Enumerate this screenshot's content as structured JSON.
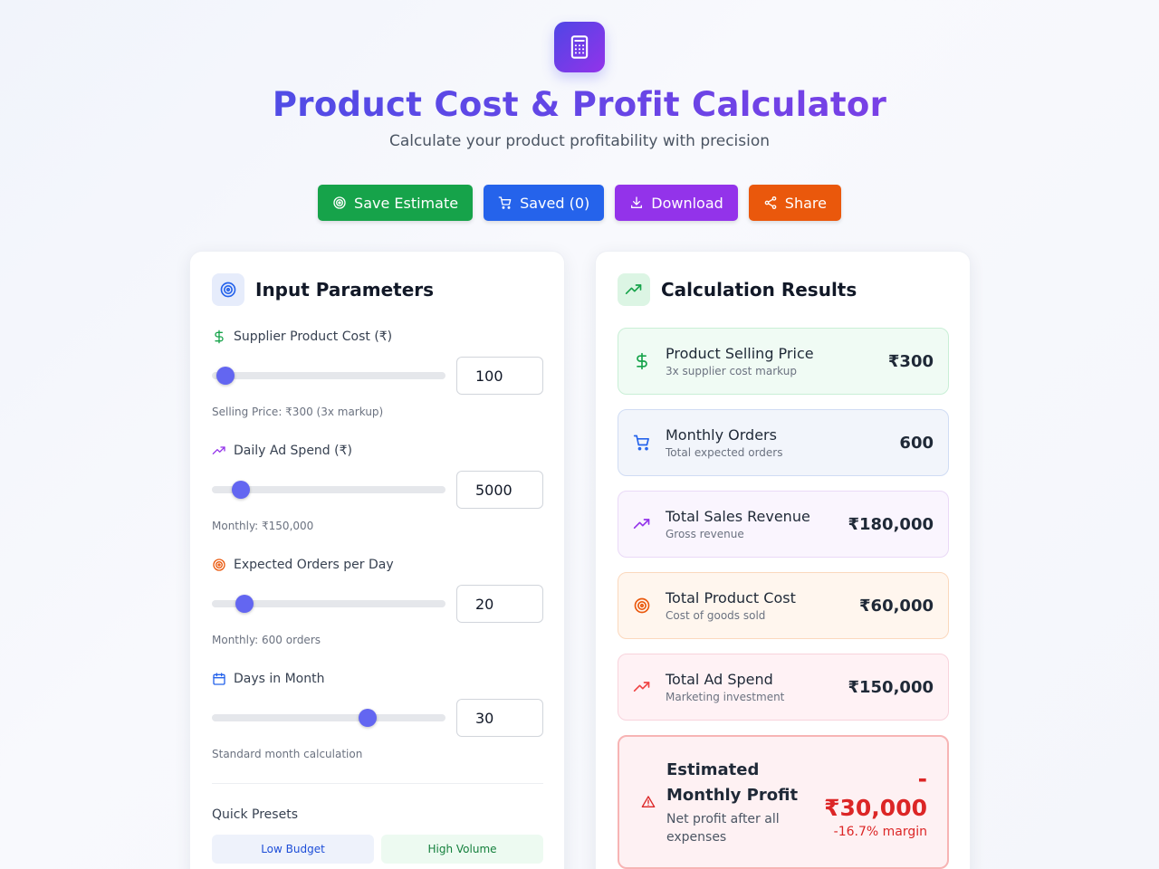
{
  "header": {
    "logo_icon": "calculator-icon",
    "title": "Product Cost & Profit Calculator",
    "subtitle": "Calculate your product profitability with precision"
  },
  "actions": {
    "save": "Save Estimate",
    "saved": "Saved (0)",
    "download": "Download",
    "share": "Share"
  },
  "inputs": {
    "title": "Input Parameters",
    "supplier_cost": {
      "label": "Supplier Product Cost (₹)",
      "value": "100",
      "slider_fraction": 0.05,
      "note": "Selling Price: ₹300 (3x markup)"
    },
    "ad_spend": {
      "label": "Daily Ad Spend (₹)",
      "value": "5000",
      "slider_fraction": 0.115,
      "note": "Monthly: ₹150,000"
    },
    "orders_per_day": {
      "label": "Expected Orders per Day",
      "value": "20",
      "slider_fraction": 0.13,
      "note": "Monthly: 600 orders"
    },
    "days_in_month": {
      "label": "Days in Month",
      "value": "30",
      "slider_fraction": 0.66,
      "note": "Standard month calculation"
    },
    "presets_title": "Quick Presets",
    "presets": [
      "Low Budget",
      "High Volume"
    ]
  },
  "results": {
    "title": "Calculation Results",
    "items": [
      {
        "label": "Product Selling Price",
        "sub": "3x supplier cost markup",
        "value": "₹300",
        "icon": "dollar-icon"
      },
      {
        "label": "Monthly Orders",
        "sub": "Total expected orders",
        "value": "600",
        "icon": "cart-icon"
      },
      {
        "label": "Total Sales Revenue",
        "sub": "Gross revenue",
        "value": "₹180,000",
        "icon": "trending-up-icon"
      },
      {
        "label": "Total Product Cost",
        "sub": "Cost of goods sold",
        "value": "₹60,000",
        "icon": "target-icon"
      },
      {
        "label": "Total Ad Spend",
        "sub": "Marketing investment",
        "value": "₹150,000",
        "icon": "trending-up-icon"
      }
    ],
    "profit": {
      "title": "Estimated Monthly Profit",
      "sub": "Net profit after all expenses",
      "value_sign": "-",
      "value": "₹30,000",
      "margin": "-16.7% margin",
      "icon": "alert-triangle-icon"
    }
  },
  "colors": {
    "accent": "#6366f1",
    "green": "#16a34a",
    "blue": "#2563eb",
    "purple": "#9333ea",
    "orange": "#ea580c",
    "red": "#dc2626"
  }
}
